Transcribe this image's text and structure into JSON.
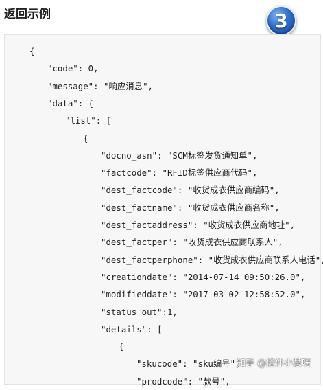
{
  "header": {
    "title": "返回示例",
    "badge_number": "3"
  },
  "code_lines": [
    {
      "indent": 0,
      "text": "{"
    },
    {
      "indent": 1,
      "text": "\"code\": 0,"
    },
    {
      "indent": 1,
      "text": "\"message\": \"响应消息\","
    },
    {
      "indent": 1,
      "text": "\"data\": {"
    },
    {
      "indent": 2,
      "text": "\"list\": ["
    },
    {
      "indent": 3,
      "text": "{"
    },
    {
      "indent": 4,
      "text": "\"docno_asn\": \"SCM标签发货通知单\","
    },
    {
      "indent": 4,
      "text": "\"factcode\": \"RFID标签供应商代码\","
    },
    {
      "indent": 4,
      "text": "\"dest_factcode\": \"收货成衣供应商编码\","
    },
    {
      "indent": 4,
      "text": "\"dest_factname\": \"收货成衣供应商名称\","
    },
    {
      "indent": 4,
      "text": "\"dest_factaddress\": \"收货成衣供应商地址\","
    },
    {
      "indent": 4,
      "text": "\"dest_factper\": \"收货成衣供应商联系人\","
    },
    {
      "indent": 4,
      "text": "\"dest_factperphone\": \"收货成衣供应商联系人电话\","
    },
    {
      "indent": 4,
      "text": "\"creationdate\": \"2014-07-14 09:50:26.0\","
    },
    {
      "indent": 4,
      "text": "\"modifieddate\": \"2017-03-02 12:58:52.0\","
    },
    {
      "indent": 4,
      "text": "\"status_out\":1,"
    },
    {
      "indent": 4,
      "text": "\"details\": ["
    },
    {
      "indent": 5,
      "text": "{"
    },
    {
      "indent": 6,
      "text": "\"skucode\": \"sku编号\","
    },
    {
      "indent": 6,
      "text": "\"prodcode\": \"款号\","
    }
  ],
  "watermark": {
    "text": "知乎 @控件小慧呀"
  }
}
